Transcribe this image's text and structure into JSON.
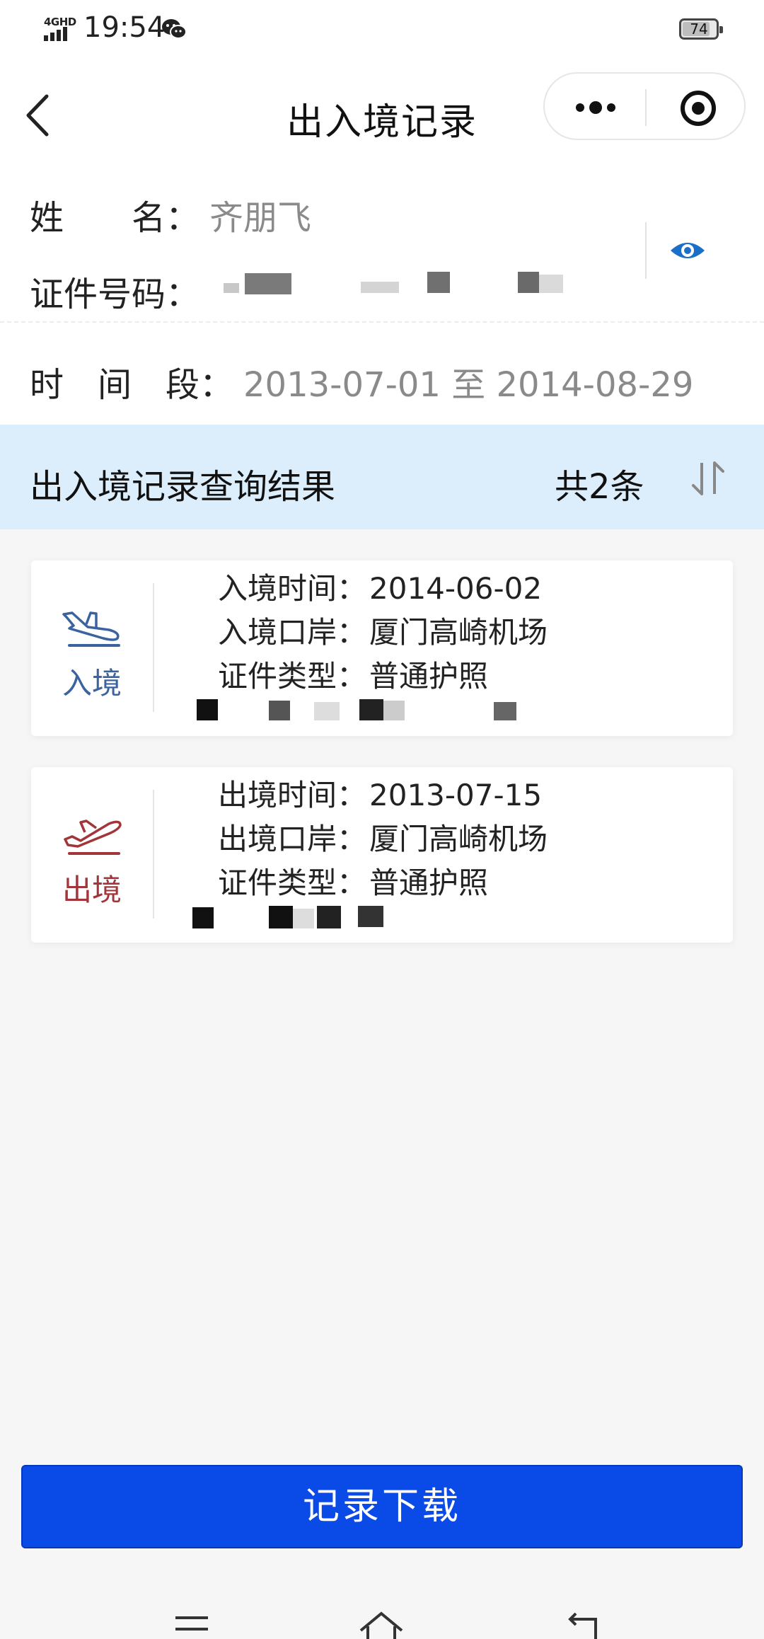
{
  "status_bar": {
    "network": "4GHD",
    "time": "19:54",
    "battery": "74",
    "icons": [
      "signal-icon",
      "wechat-icon",
      "battery-icon"
    ]
  },
  "nav": {
    "title": "出入境记录",
    "icons": [
      "back-icon",
      "more-icon",
      "target-icon"
    ]
  },
  "info": {
    "name_label": "姓　　名：",
    "name_value": "齐朋飞",
    "id_label": "证件号码：",
    "period_label": "时　间　段：",
    "period_value": "2013-07-01 至 2014-08-29"
  },
  "results": {
    "title": "出入境记录查询结果",
    "count": "共2条",
    "records": [
      {
        "direction": "入境",
        "time_label": "入境时间：",
        "time_value": "2014-06-02",
        "port_label": "入境口岸：",
        "port_value": "厦门高崎机场",
        "doc_type_label": "证件类型：",
        "doc_type_value": "普通护照",
        "color": "#3a63a0"
      },
      {
        "direction": "出境",
        "time_label": "出境时间：",
        "time_value": "2013-07-15",
        "port_label": "出境口岸：",
        "port_value": "厦门高崎机场",
        "doc_type_label": "证件类型：",
        "doc_type_value": "普通护照",
        "color": "#a2353a"
      }
    ]
  },
  "download_button": "记录下载",
  "colors": {
    "primary": "#0a4ae6",
    "header_bg": "#dceefc",
    "eye": "#1a6fc9"
  }
}
